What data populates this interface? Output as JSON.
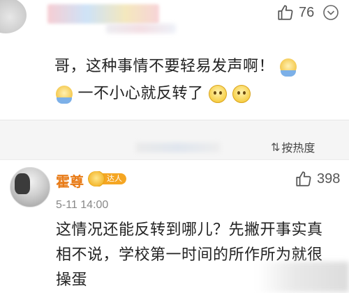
{
  "comment1": {
    "like_count": "76",
    "text_line1": "哥，这种事情不要轻易发声啊！",
    "text_line2": "一不小心就反转了"
  },
  "sort": {
    "label": "按热度",
    "icon": "sort-icon"
  },
  "comment2": {
    "username": "霍尊",
    "badge_text": "达人",
    "like_count": "398",
    "timestamp": "5-11 14:00",
    "text": "这情况还能反转到哪儿？先撇开事实真相不说，学校第一时间的所作所为就很操蛋"
  },
  "colors": {
    "username": "#e87b17",
    "badge": "#f5a623",
    "muted_text": "#888888",
    "band_bg": "#f5f5f5"
  },
  "icons": [
    "thumb-up-icon",
    "chevron-down-icon",
    "dog-emoji-icon",
    "sad-emoji-icon",
    "badge-icon"
  ]
}
